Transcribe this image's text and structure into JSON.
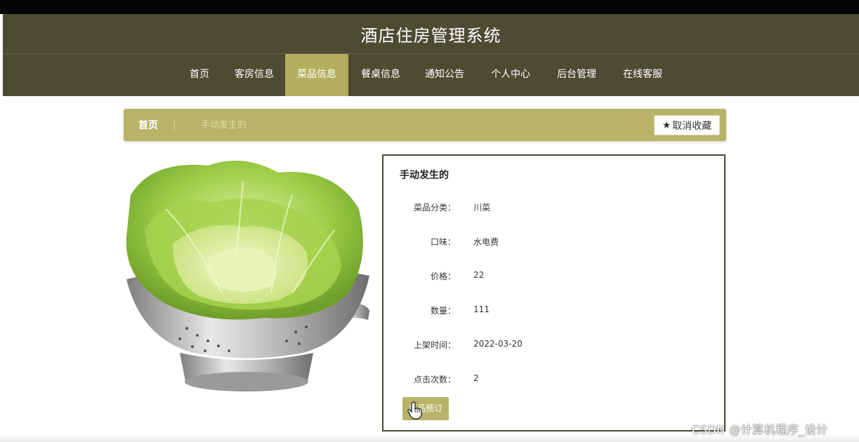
{
  "header": {
    "title": "酒店住房管理系统"
  },
  "nav": {
    "items": [
      {
        "label": "首页"
      },
      {
        "label": "客房信息"
      },
      {
        "label": "菜品信息"
      },
      {
        "label": "餐桌信息"
      },
      {
        "label": "通知公告"
      },
      {
        "label": "个人中心"
      },
      {
        "label": "后台管理"
      },
      {
        "label": "在线客服"
      }
    ],
    "active": "菜品信息"
  },
  "breadcrumb": {
    "home": "首页",
    "separator": "|",
    "current": "手动发生的"
  },
  "favorite": {
    "label": "取消收藏",
    "icon": "star-icon"
  },
  "detail": {
    "title": "手动发生的",
    "fields": [
      {
        "label": "菜品分类：",
        "value": "川菜"
      },
      {
        "label": "口味：",
        "value": "水电费"
      },
      {
        "label": "价格：",
        "value": "22"
      },
      {
        "label": "数量：",
        "value": "111"
      },
      {
        "label": "上架时间：",
        "value": "2022-03-20"
      },
      {
        "label": "点击次数：",
        "value": "2"
      }
    ],
    "order_label": "菜品预订"
  },
  "watermark": "CSDN @计算机程序_设计",
  "colors": {
    "header_bg": "#4d4b32",
    "accent": "#b8b368",
    "active_tab": "#b3af5e"
  }
}
